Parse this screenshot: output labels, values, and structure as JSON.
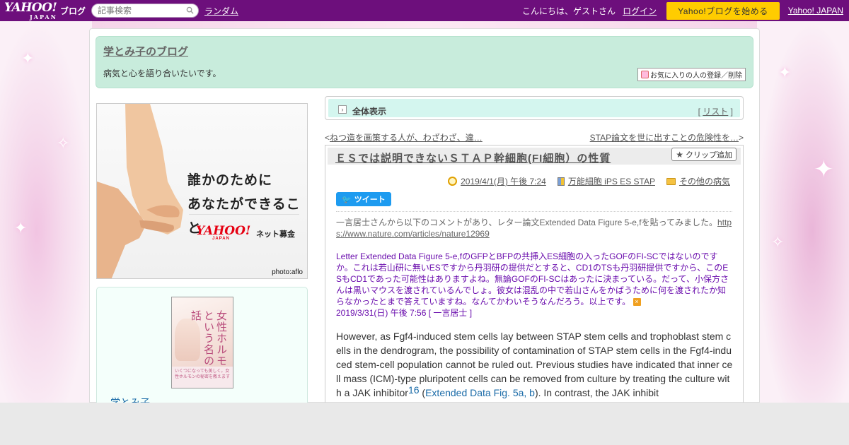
{
  "topbar": {
    "logo_text": "YAHOO!",
    "logo_sub": "JAPAN",
    "blog_label": "ブログ",
    "search_placeholder": "記事検索",
    "random_link": "ランダム",
    "greeting": "こんにちは、ゲストさん",
    "login_link": "ログイン",
    "start_button": "Yahoo!ブログを始める",
    "yahoo_japan_link": "Yahoo! JAPAN"
  },
  "header": {
    "blog_title": "学とみ子のブログ",
    "description": "病気と心を語り合いたいです。",
    "favorite_button": "お気に入りの人の登録／削除"
  },
  "ad": {
    "line1": "誰かのために",
    "line2": "あなたができること",
    "brand": "YAHOO!",
    "brand_sub": "JAPAN",
    "service": "ネット募金",
    "credit": "photo:aflo"
  },
  "profile": {
    "book_title": "女性ホルモンという名の神話",
    "book_band": "いくつになっても美しく。女性ホルモンの秘密を教えます",
    "name": "学とみ子"
  },
  "viewbar": {
    "view_all": "全体表示",
    "list_open": "[",
    "list_link": "リスト",
    "list_close": "]"
  },
  "nav": {
    "prev_arrow": "<",
    "prev_title": "ねつ造を画策する人が、わざわざ、違…",
    "next_title": "STAP論文を世に出すことの危険性を…",
    "next_arrow": ">"
  },
  "article": {
    "title": "ＥＳでは説明できないＳＴＡＰ幹細胞(FI細胞）の性質",
    "clip_button": "クリップ追加",
    "date": "2019/4/1(月) 午後 7:24",
    "category": "万能細胞 iPS ES STAP",
    "folder": "その他の病気",
    "tweet_button": "ツイート",
    "intro": "一言居士さんから以下のコメントがあり、レター論文Extended Data Figure 5-e,fを貼ってみました。",
    "intro_url": "https://www.nature.com/articles/nature12969",
    "comment": "Letter Extended Data Figure 5-e,fのGFPとBFPの共挿入ES細胞の入ったGOFのFI-SCではないのですか。これは若山研に無いESですから丹羽研の提供だとすると、CD1のTSも丹羽研提供ですから、このESもCD1であった可能性はありますよね。無論GOFのFI-SCはあったに決まっている。だって、小保方さんは黒いマウスを渡されているんでしょ。彼女は混乱の中で若山さんをかばうために何を渡されたか知らなかったとまで答えていますね。なんてかわいそうなんだろう。以上です。",
    "comment_meta": "2019/3/31(日) 午後 7:56 [ 一言居士 ]",
    "quote_part1": "However, as Fgf4-induced stem cells lay between STAP stem cells and trophoblast stem cells in the dendrogram, the possibility of contamination of STAP stem cells in the Fgf4-induced stem-cell population cannot be ruled out. Previous studies have indicated that inner cell mass (ICM)-type pluripotent cells can be removed from culture by treating the culture with a JAK inhibitor",
    "quote_sup": "16",
    "quote_open": " (",
    "quote_ref": "Extended Data Fig. 5a, b",
    "quote_part2": "). In contrast, the JAK inhibit"
  },
  "colors": {
    "topbar": "#6d0f7c",
    "header_bg": "#c8ecdc",
    "viewbar_bg": "#d4f6ef",
    "start_button": "#ffcc00",
    "comment_text": "#6a0dad",
    "link_blue": "#1a6ba8"
  }
}
